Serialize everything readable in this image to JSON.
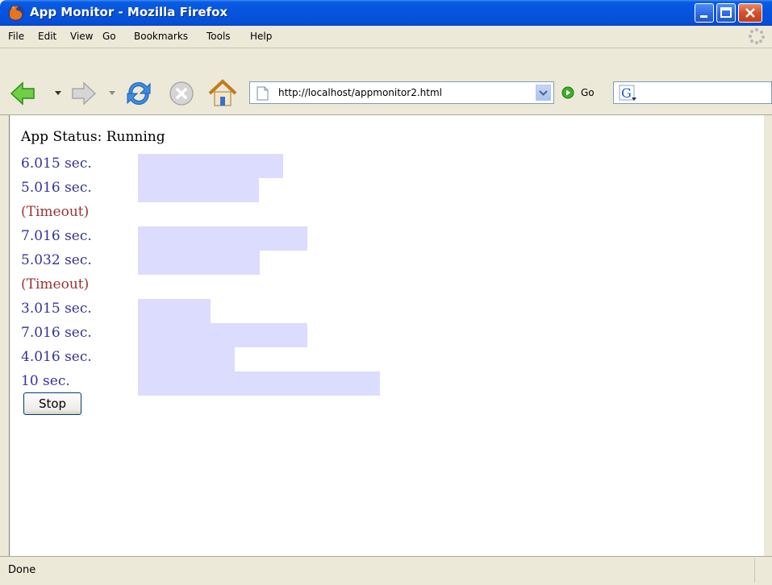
{
  "window": {
    "title": "App Monitor - Mozilla Firefox"
  },
  "menu": [
    "File",
    "Edit",
    "View",
    "Go",
    "Bookmarks",
    "Tools",
    "Help"
  ],
  "navbar": {
    "url": "http://localhost/appmonitor2.html",
    "go_label": "Go"
  },
  "page": {
    "status": "App Status: Running",
    "results": [
      {
        "label": "6.015 sec.",
        "timeout": false,
        "seconds": 6.015
      },
      {
        "label": "5.016 sec.",
        "timeout": false,
        "seconds": 5.016
      },
      {
        "label": "(Timeout)",
        "timeout": true,
        "seconds": 0
      },
      {
        "label": "7.016 sec.",
        "timeout": false,
        "seconds": 7.016
      },
      {
        "label": "5.032 sec.",
        "timeout": false,
        "seconds": 5.032
      },
      {
        "label": "(Timeout)",
        "timeout": true,
        "seconds": 0
      },
      {
        "label": "3.015 sec.",
        "timeout": false,
        "seconds": 3.015
      },
      {
        "label": "7.016 sec.",
        "timeout": false,
        "seconds": 7.016
      },
      {
        "label": "4.016 sec.",
        "timeout": false,
        "seconds": 4.016
      },
      {
        "label": "10 sec.",
        "timeout": false,
        "seconds": 10
      }
    ],
    "stop_label": "Stop"
  },
  "statusbar": {
    "text": "Done"
  },
  "colors": {
    "ok": "#333399",
    "timeout": "#993333",
    "bar": "#dcdcff"
  },
  "icons": [
    "firefox-icon",
    "back-icon",
    "forward-icon",
    "reload-icon",
    "stop-icon",
    "home-icon",
    "page-icon",
    "go-icon",
    "google-icon",
    "throbber-icon"
  ]
}
